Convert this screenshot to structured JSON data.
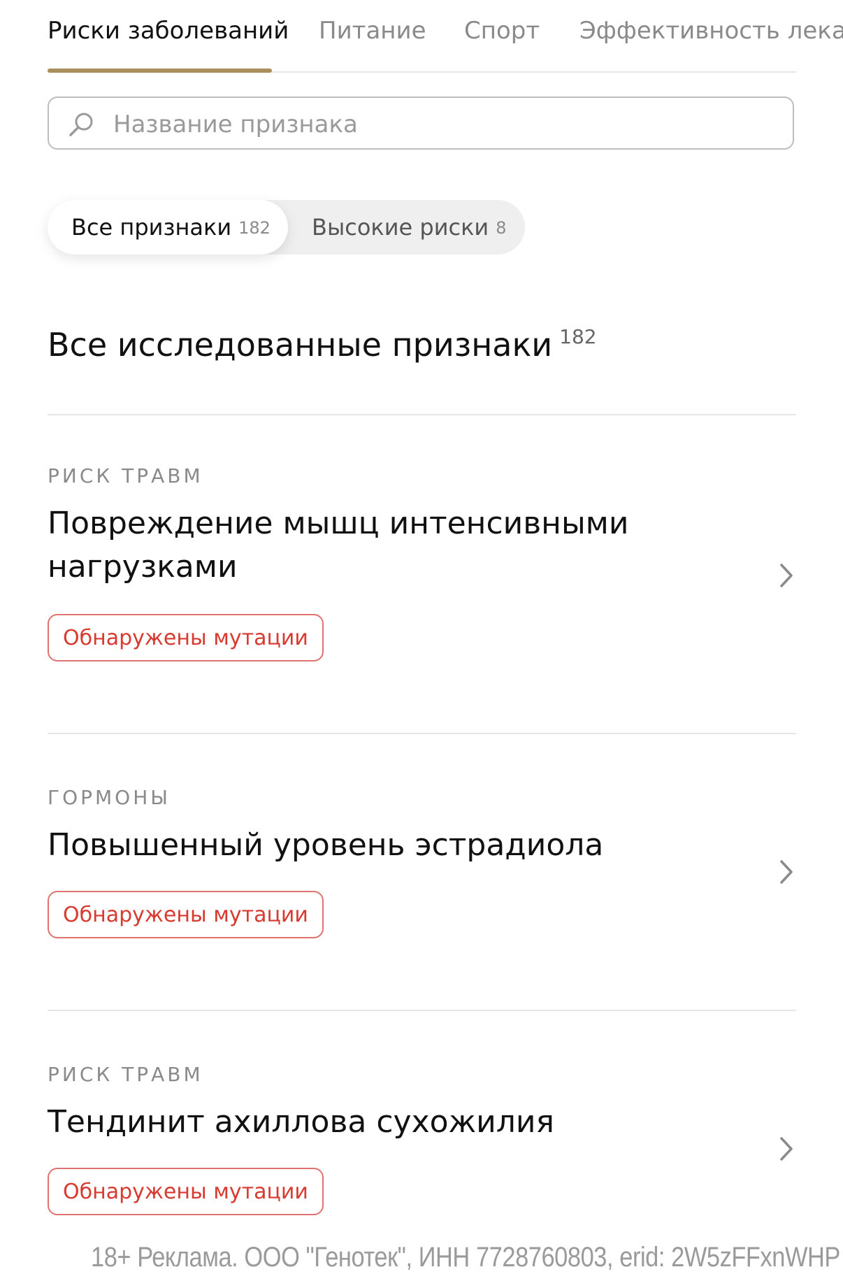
{
  "tabs": [
    {
      "label": "Риски заболеваний",
      "active": true
    },
    {
      "label": "Питание",
      "active": false
    },
    {
      "label": "Спорт",
      "active": false
    },
    {
      "label": "Эффективность лекарств",
      "active": false
    }
  ],
  "search": {
    "placeholder": "Название признака",
    "icon": "search-icon"
  },
  "filters": [
    {
      "label": "Все признаки",
      "count": "182",
      "active": true
    },
    {
      "label": "Высокие риски",
      "count": "8",
      "active": false
    }
  ],
  "section": {
    "title": "Все исследованные признаки",
    "count": "182"
  },
  "cards": [
    {
      "category": "РИСК ТРАВМ",
      "title": "Повреждение мышц интенсивными нагрузками",
      "badge": "Обнаружены мутации"
    },
    {
      "category": "ГОРМОНЫ",
      "title": "Повышенный уровень эстрадиола",
      "badge": "Обнаружены мутации"
    },
    {
      "category": "РИСК ТРАВМ",
      "title": "Тендинит ахиллова сухожилия",
      "badge": "Обнаружены мутации"
    }
  ],
  "ad_text": "18+ Реклама. ООО \"Генотек\", ИНН 7728760803, erid: 2W5zFFxnWHP",
  "colors": {
    "accent": "#a88f5c",
    "badge_red": "#d83a2f",
    "badge_border": "#e0736f",
    "muted_text": "#8a8a8a"
  }
}
